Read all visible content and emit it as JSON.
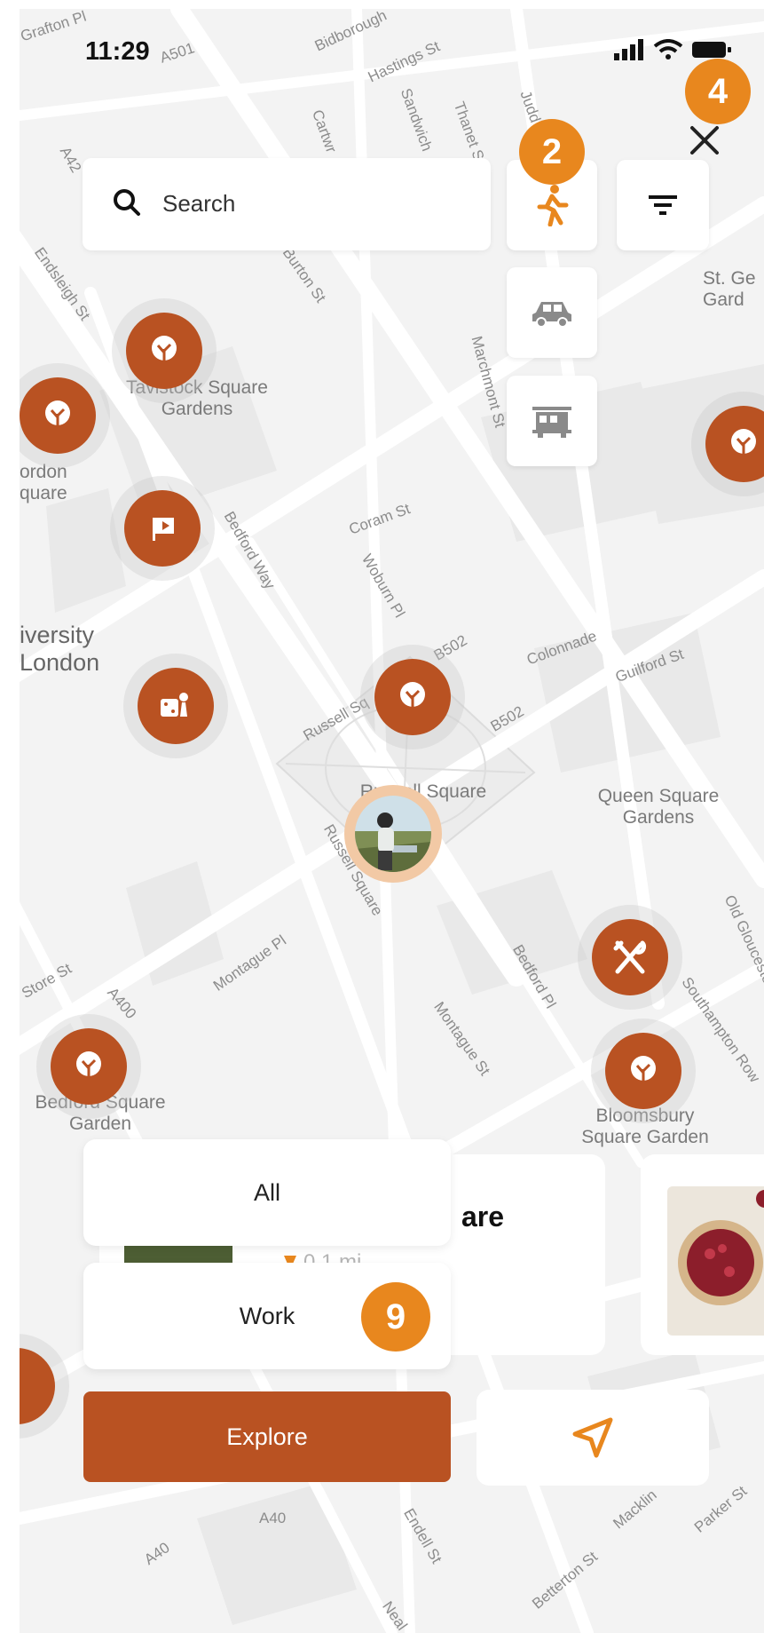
{
  "status_bar": {
    "time": "11:29"
  },
  "search": {
    "placeholder": "Search"
  },
  "badges": {
    "walk": "2",
    "close": "4",
    "work": "9"
  },
  "filters": {
    "all": "All",
    "work": "Work"
  },
  "buttons": {
    "explore": "Explore"
  },
  "card": {
    "title_fragment": "are",
    "distance_fragment": "0.1 mi"
  },
  "map_labels": {
    "tavistock": "Tavistock Square Gardens",
    "gordon": "ordon quare",
    "university": "iversity London",
    "russell": "Russell Square",
    "queen": "Queen Square Gardens",
    "bedford": "Bedford Square Garden",
    "bloomsbury": "Bloomsbury Square Garden",
    "st_george": "St. Ge Gard"
  },
  "streets": [
    "Grafton Pl",
    "A501",
    "Bidborough",
    "Hastings St",
    "Cartwr",
    "Sandwich",
    "Thanet St",
    "Judd St",
    "Burton St",
    "Endsleigh St",
    "A42",
    "Marchmont St",
    "Coram St",
    "Bedford Way",
    "Woburn Pl",
    "B502",
    "Colonnade",
    "Guilford St",
    "B502",
    "Russell Sq",
    "Russell Square",
    "Montague Pl",
    "Bedford Pl",
    "Montague St",
    "Old Gloucester St",
    "Southampton Row",
    "A400",
    "Store St",
    "A40",
    "Endell St",
    "Betterton St",
    "Parker St",
    "Macklin",
    "Neal",
    "A40"
  ],
  "colors": {
    "accent": "#b95222",
    "badge": "#e8871e",
    "map_bg": "#f3f3f3"
  },
  "icons": {
    "search": "search-icon",
    "walk": "walking-icon",
    "car": "car-icon",
    "tram": "tram-icon",
    "filter": "filter-icon",
    "close": "close-icon",
    "tree": "tree-icon",
    "flag": "flag-icon",
    "games": "games-icon",
    "restaurant": "restaurant-icon",
    "navigate": "navigation-arrow-icon"
  }
}
